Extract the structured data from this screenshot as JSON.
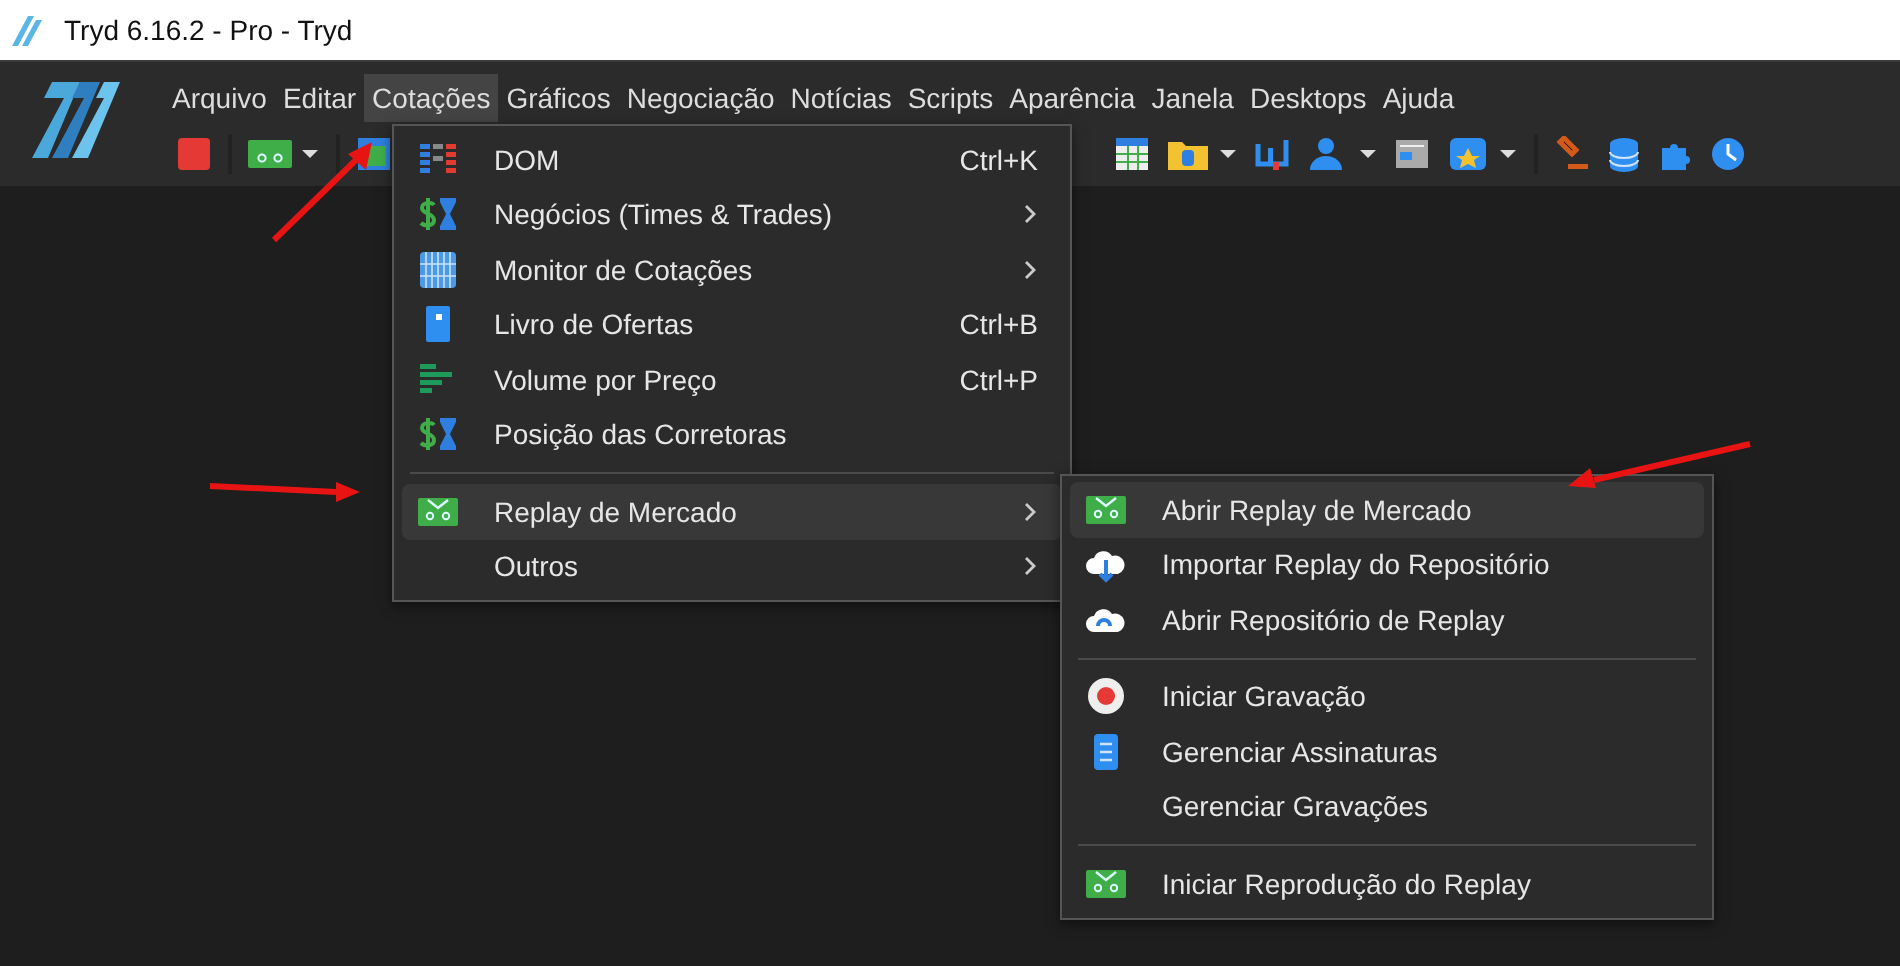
{
  "window": {
    "title": "Tryd 6.16.2 - Pro - Tryd"
  },
  "menu_bar": [
    {
      "label": "Arquivo",
      "selected": false
    },
    {
      "label": "Editar",
      "selected": false
    },
    {
      "label": "Cotações",
      "selected": true
    },
    {
      "label": "Gráficos",
      "selected": false
    },
    {
      "label": "Negociação",
      "selected": false
    },
    {
      "label": "Notícias",
      "selected": false
    },
    {
      "label": "Scripts",
      "selected": false
    },
    {
      "label": "Aparência",
      "selected": false
    },
    {
      "label": "Janela",
      "selected": false
    },
    {
      "label": "Desktops",
      "selected": false
    },
    {
      "label": "Ajuda",
      "selected": false
    }
  ],
  "dropdown_menu": {
    "items": [
      {
        "kind": "item",
        "label": "DOM",
        "shortcut": "Ctrl+K",
        "has_submenu": false,
        "selected": false
      },
      {
        "kind": "item",
        "label": "Negócios (Times & Trades)",
        "has_submenu": true,
        "selected": false
      },
      {
        "kind": "item",
        "label": "Monitor de Cotações",
        "has_submenu": true,
        "selected": false
      },
      {
        "kind": "item",
        "label": "Livro de Ofertas",
        "shortcut": "Ctrl+B",
        "has_submenu": false,
        "selected": false
      },
      {
        "kind": "item",
        "label": "Volume por Preço",
        "shortcut": "Ctrl+P",
        "has_submenu": false,
        "selected": false
      },
      {
        "kind": "item",
        "label": "Posição das Corretoras",
        "has_submenu": false,
        "selected": false
      },
      {
        "kind": "separator"
      },
      {
        "kind": "item",
        "label": "Replay de Mercado",
        "has_submenu": true,
        "selected": true
      },
      {
        "kind": "item",
        "label": "Outros",
        "has_submenu": true,
        "selected": false
      }
    ]
  },
  "submenu": {
    "items": [
      {
        "kind": "item",
        "label": "Abrir Replay de Mercado",
        "selected": true
      },
      {
        "kind": "item",
        "label": "Importar Replay do Repositório",
        "selected": false
      },
      {
        "kind": "item",
        "label": "Abrir Repositório de Replay",
        "selected": false
      },
      {
        "kind": "separator"
      },
      {
        "kind": "item",
        "label": "Iniciar Gravação",
        "selected": false
      },
      {
        "kind": "item",
        "label": "Gerenciar Assinaturas",
        "selected": false
      },
      {
        "kind": "item",
        "label": "Gerenciar Gravações",
        "selected": false
      },
      {
        "kind": "separator"
      },
      {
        "kind": "item",
        "label": "Iniciar Reprodução do Replay",
        "selected": false
      }
    ]
  }
}
